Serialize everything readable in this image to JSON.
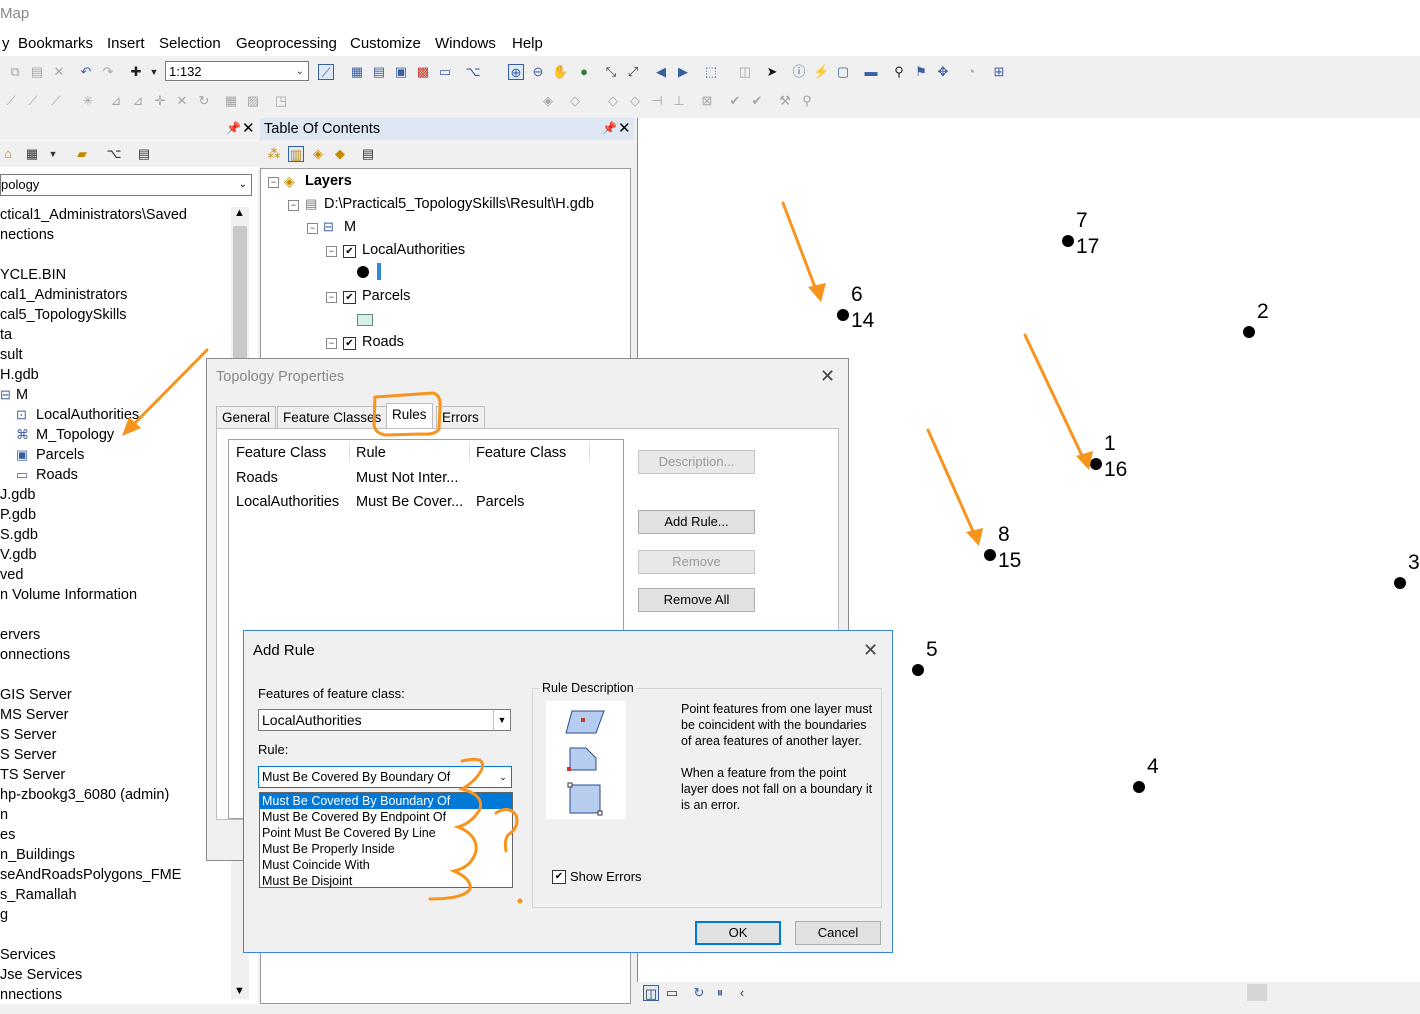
{
  "app": {
    "title_fragment": "Map"
  },
  "menu": [
    "Bookmarks",
    "Insert",
    "Selection",
    "Geoprocessing",
    "Customize",
    "Windows",
    "Help"
  ],
  "scale": {
    "value": "1:132"
  },
  "catalog": {
    "combo_value": "pology",
    "items": [
      "ctical1_Administrators\\Saved",
      "nections",
      "",
      "YCLE.BIN",
      "cal1_Administrators",
      "cal5_TopologySkills",
      "ta",
      "sult",
      "H.gdb",
      "M",
      "LocalAuthorities",
      "M_Topology",
      "Parcels",
      "Roads",
      "J.gdb",
      "P.gdb",
      "S.gdb",
      "V.gdb",
      "ved",
      "n Volume Information",
      "",
      "ervers",
      "onnections",
      "",
      "GIS Server",
      "MS Server",
      "S Server",
      "S Server",
      "TS Server",
      " hp-zbookg3_6080 (admin)",
      "n",
      "es",
      "n_Buildings",
      "seAndRoadsPolygons_FME",
      "s_Ramallah",
      "g",
      "",
      "Services",
      "Jse Services",
      "nnections"
    ]
  },
  "toc": {
    "title": "Table Of Contents",
    "layers_label": "Layers",
    "gdb_path": "D:\\Practical5_TopologySkills\\Result\\H.gdb",
    "dataset": "M",
    "layers": [
      "LocalAuthorities",
      "Parcels",
      "Roads"
    ]
  },
  "map": {
    "points": [
      {
        "top": "7",
        "bottom": "17"
      },
      {
        "top": "6",
        "bottom": "14"
      },
      {
        "top": "2",
        "bottom": ""
      },
      {
        "top": "1",
        "bottom": "16"
      },
      {
        "top": "8",
        "bottom": "15"
      },
      {
        "top": "3",
        "bottom": ""
      },
      {
        "top": "5",
        "bottom": ""
      },
      {
        "top": "4",
        "bottom": ""
      }
    ]
  },
  "topology_dialog": {
    "title": "Topology Properties",
    "tabs": [
      "General",
      "Feature Classes",
      "Rules",
      "Errors"
    ],
    "columns": [
      "Feature Class",
      "Rule",
      "Feature Class"
    ],
    "rows": [
      [
        "Roads",
        "Must Not Inter...",
        ""
      ],
      [
        "LocalAuthorities",
        "Must Be Cover...",
        "Parcels"
      ]
    ],
    "buttons": {
      "description": "Description...",
      "add_rule": "Add Rule...",
      "remove": "Remove",
      "remove_all": "Remove All"
    }
  },
  "add_rule_dialog": {
    "title": "Add Rule",
    "features_label": "Features of feature class:",
    "feature_class_value": "LocalAuthorities",
    "rule_label": "Rule:",
    "rule_value": "Must Be Covered By Boundary Of",
    "rule_options": [
      "Must Be Covered By Boundary Of",
      "Must Be Covered By Endpoint Of",
      "Point Must Be Covered By Line",
      "Must Be Properly Inside",
      "Must Coincide With",
      "Must Be Disjoint"
    ],
    "rule_description_label": "Rule Description",
    "description_p1": "Point features from one layer must be coincident with the boundaries of area features of another layer.",
    "description_p2": "When a feature from the point layer does not fall on a boundary it is an error.",
    "show_errors_label": "Show Errors",
    "show_errors_checked": true,
    "ok_label": "OK",
    "cancel_label": "Cancel"
  },
  "annotation_colors": {
    "orange": "#f7941d",
    "selection": "#0078d7"
  }
}
